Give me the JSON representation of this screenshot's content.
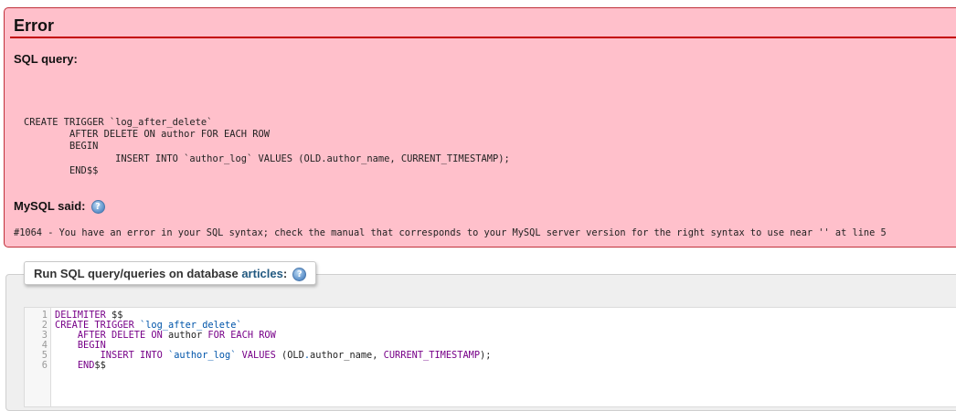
{
  "error": {
    "title": "Error",
    "sql_query_label": "SQL query:",
    "sql_lines": [
      "CREATE TRIGGER `log_after_delete`",
      "        AFTER DELETE ON author FOR EACH ROW",
      "        BEGIN",
      "                INSERT INTO `author_log` VALUES (OLD.author_name, CURRENT_TIMESTAMP);",
      "        END$$"
    ],
    "mysql_said_label": "MySQL said:",
    "message": "#1064 - You have an error in your SQL syntax; check the manual that corresponds to your MySQL server version for the right syntax to use near '' at line 5"
  },
  "query_panel": {
    "legend_prefix": "Run SQL query/queries on database ",
    "database": "articles",
    "legend_suffix": ":"
  },
  "editor": {
    "line_numbers": [
      "1",
      "2",
      "3",
      "4",
      "5",
      "6"
    ],
    "tokens": {
      "l1_kw": "DELIMITER",
      "l1_rest": " $$",
      "l2_kw": "CREATE TRIGGER",
      "l2_str": "`log_after_delete`",
      "l3_kw1": "AFTER DELETE ON",
      "l3_id": "author",
      "l3_kw2": "FOR EACH ROW",
      "l4_kw": "BEGIN",
      "l5_kw1": "INSERT INTO",
      "l5_str": "`author_log`",
      "l5_kw2": "VALUES",
      "l5_p1": "(OLD",
      "l5_dot": ".",
      "l5_p2": "author_name,",
      "l5_kw3": "CURRENT_TIMESTAMP",
      "l5_p3": ");",
      "l6_kw": "END",
      "l6_rest": "$$"
    }
  },
  "colors": {
    "error_bg": "#ffc0cb",
    "error_rule": "#c40000",
    "keyword": "#770088",
    "string": "#0055aa",
    "link": "#235a81"
  },
  "icons": {
    "help": "question-mark-icon"
  }
}
